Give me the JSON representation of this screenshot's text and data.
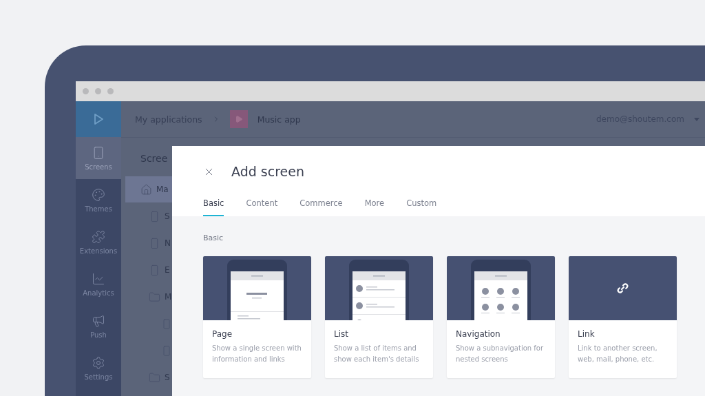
{
  "sidebar": {
    "items": [
      {
        "label": "Screens",
        "selected": true
      },
      {
        "label": "Themes",
        "selected": false
      },
      {
        "label": "Extensions",
        "selected": false
      },
      {
        "label": "Analytics",
        "selected": false
      },
      {
        "label": "Push",
        "selected": false
      },
      {
        "label": "Settings",
        "selected": false
      }
    ]
  },
  "topbar": {
    "breadcrumb": [
      "My applications",
      "Music app"
    ],
    "user": "demo@shoutem.com"
  },
  "screens_panel": {
    "title": "Scree",
    "items": [
      {
        "kind": "home",
        "label": "Ma",
        "selected": true
      },
      {
        "kind": "screen",
        "label": "S",
        "selected": false
      },
      {
        "kind": "screen",
        "label": "N",
        "selected": false
      },
      {
        "kind": "screen",
        "label": "E",
        "selected": false
      },
      {
        "kind": "folder",
        "label": "M",
        "selected": false,
        "children": [
          {
            "kind": "screen",
            "selected": false
          },
          {
            "kind": "screen",
            "selected": false
          }
        ]
      },
      {
        "kind": "folder",
        "label": "S",
        "selected": false
      }
    ]
  },
  "modal": {
    "title": "Add screen",
    "tabs": [
      {
        "label": "Basic",
        "selected": true
      },
      {
        "label": "Content",
        "selected": false
      },
      {
        "label": "Commerce",
        "selected": false
      },
      {
        "label": "More",
        "selected": false
      },
      {
        "label": "Custom",
        "selected": false
      }
    ],
    "section": "Basic",
    "cards": [
      {
        "kind": "page",
        "title": "Page",
        "description": "Show a single screen with information and links"
      },
      {
        "kind": "list",
        "title": "List",
        "description": "Show a list of items and show each item's details"
      },
      {
        "kind": "navigation",
        "title": "Navigation",
        "description": "Show a subnavigation for nested screens"
      },
      {
        "kind": "link",
        "title": "Link",
        "description": "Link to another screen, web, mail, phone, etc."
      }
    ]
  }
}
